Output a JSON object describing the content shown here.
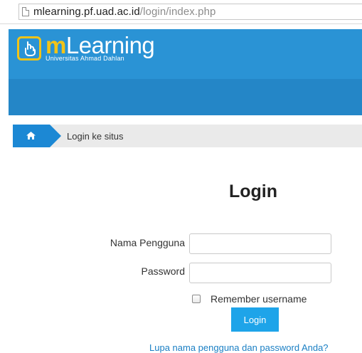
{
  "browser": {
    "url_domain": "mlearning.pf.uad.ac.id",
    "url_path": "/login/index.php"
  },
  "header": {
    "logo_prefix": "m",
    "logo_name": "Learning",
    "logo_subtitle": "Universitas Ahmad Dahlan"
  },
  "breadcrumb": {
    "home_icon": "home-icon",
    "current": "Login ke situs"
  },
  "login": {
    "title": "Login",
    "username_label": "Nama Pengguna",
    "username_value": "",
    "password_label": "Password",
    "password_value": "",
    "remember_label": "Remember username",
    "remember_checked": false,
    "submit_label": "Login",
    "forgot_link": "Lupa nama pengguna dan password Anda?"
  },
  "colors": {
    "header_blue": "#2a93d5",
    "accent_yellow": "#f3c316",
    "button_blue": "#1ea4e9",
    "link_blue": "#1a7fc4"
  }
}
